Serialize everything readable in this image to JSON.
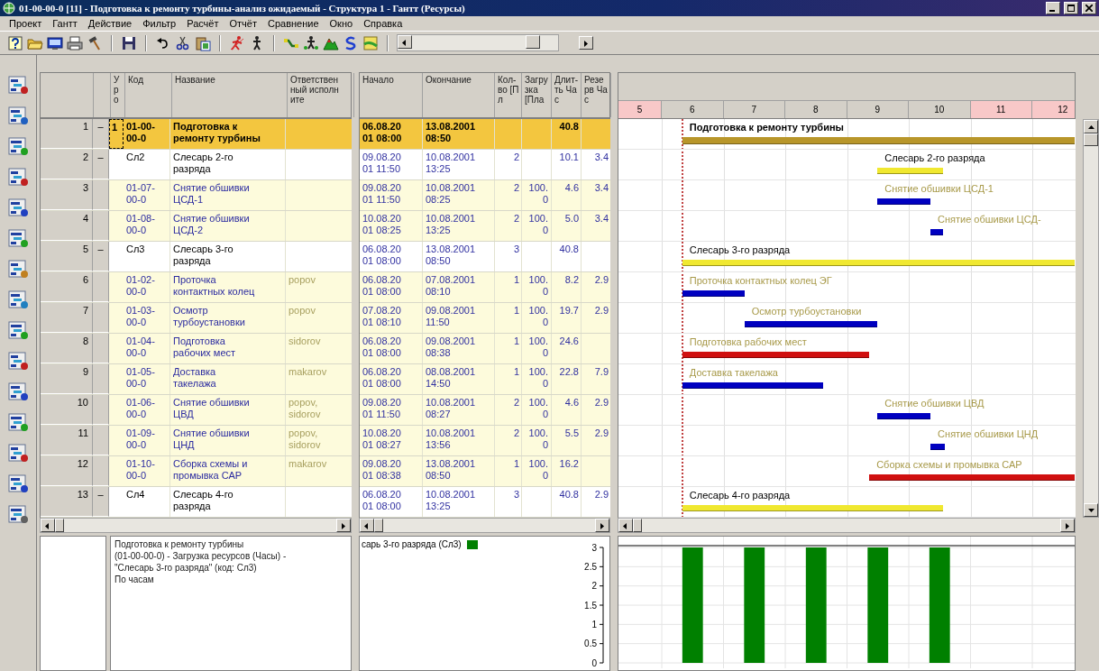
{
  "window": {
    "title": "01-00-00-0 [11] - Подготовка к ремонту турбины-анализ ожидаемый - Структура 1 - Гантт (Ресурсы)"
  },
  "menu": [
    "Проект",
    "Гантт",
    "Действие",
    "Фильтр",
    "Расчёт",
    "Отчёт",
    "Сравнение",
    "Окно",
    "Справка"
  ],
  "table": {
    "left_columns": [
      "Уро",
      "Код",
      "Название",
      "Ответственный исполните"
    ],
    "right_columns": [
      "Начало",
      "Окончание",
      "Кол-во [Пл",
      "Загрузка [Пла",
      "Длит-ть Час",
      "Резерв Час"
    ],
    "rows": [
      {
        "num": "1",
        "marker": "–",
        "outline_level": "1",
        "code": "01-00-00-0",
        "name": "Подготовка к ремонту турбины",
        "start": "06.08.2001 08:00",
        "end": "13.08.2001 08:50",
        "duration": "40.8",
        "kind": "summary",
        "selected": true
      },
      {
        "num": "2",
        "marker": "–",
        "code": "Сл2",
        "name": "Слесарь 2-го разряда",
        "start": "09.08.2001 11:50",
        "end": "10.08.2001 13:25",
        "qty": "2",
        "duration": "10.1",
        "reserve": "3.4",
        "kind": "resource",
        "selected": false
      },
      {
        "num": "3",
        "code": "01-07-00-0",
        "name": "Снятие обшивки ЦСД-1",
        "start": "09.08.2001 11:50",
        "end": "10.08.2001 08:25",
        "qty": "2",
        "load": "100.0",
        "duration": "4.6",
        "reserve": "3.4",
        "kind": "task",
        "selected": false
      },
      {
        "num": "4",
        "code": "01-08-00-0",
        "name": "Снятие обшивки ЦСД-2",
        "start": "10.08.2001 08:25",
        "end": "10.08.2001 13:25",
        "qty": "2",
        "load": "100.0",
        "duration": "5.0",
        "reserve": "3.4",
        "kind": "task",
        "selected": false
      },
      {
        "num": "5",
        "marker": "–",
        "code": "Сл3",
        "name": "Слесарь 3-го разряда",
        "start": "06.08.2001 08:00",
        "end": "13.08.2001 08:50",
        "qty": "3",
        "duration": "40.8",
        "kind": "resource",
        "selected": false
      },
      {
        "num": "6",
        "code": "01-02-00-0",
        "name": "Проточка контактных колец",
        "responsible": "popov",
        "start": "06.08.2001 08:00",
        "end": "07.08.2001 08:10",
        "qty": "1",
        "load": "100.0",
        "duration": "8.2",
        "reserve": "2.9",
        "kind": "task",
        "selected": false
      },
      {
        "num": "7",
        "code": "01-03-00-0",
        "name": "Осмотр турбоустановки",
        "responsible": "popov",
        "start": "07.08.2001 08:10",
        "end": "09.08.2001 11:50",
        "qty": "1",
        "load": "100.0",
        "duration": "19.7",
        "reserve": "2.9",
        "kind": "task",
        "selected": false
      },
      {
        "num": "8",
        "code": "01-04-00-0",
        "name": "Подготовка рабочих мест",
        "responsible": "sidorov",
        "start": "06.08.2001 08:00",
        "end": "09.08.2001 08:38",
        "qty": "1",
        "load": "100.0",
        "duration": "24.6",
        "kind": "task",
        "selected": false
      },
      {
        "num": "9",
        "code": "01-05-00-0",
        "name": "Доставка такелажа",
        "responsible": "makarov",
        "start": "06.08.2001 08:00",
        "end": "08.08.2001 14:50",
        "qty": "1",
        "load": "100.0",
        "duration": "22.8",
        "reserve": "7.9",
        "kind": "task",
        "selected": false
      },
      {
        "num": "10",
        "code": "01-06-00-0",
        "name": "Снятие обшивки ЦВД",
        "responsible": "popov, sidorov",
        "start": "09.08.2001 11:50",
        "end": "10.08.2001 08:27",
        "qty": "2",
        "load": "100.0",
        "duration": "4.6",
        "reserve": "2.9",
        "kind": "task",
        "selected": false
      },
      {
        "num": "11",
        "code": "01-09-00-0",
        "name": "Снятие обшивки ЦНД",
        "responsible": "popov, sidorov",
        "start": "10.08.2001 08:27",
        "end": "10.08.2001 13:56",
        "qty": "2",
        "load": "100.0",
        "duration": "5.5",
        "reserve": "2.9",
        "kind": "task",
        "selected": false
      },
      {
        "num": "12",
        "code": "01-10-00-0",
        "name": "Сборка схемы и промывка САР",
        "responsible": "makarov",
        "start": "09.08.2001 08:38",
        "end": "13.08.2001 08:50",
        "qty": "1",
        "load": "100.0",
        "duration": "16.2",
        "kind": "task",
        "selected": false
      },
      {
        "num": "13",
        "marker": "–",
        "code": "Сл4",
        "name": "Слесарь 4-го разряда",
        "start": "06.08.2001 08:00",
        "end": "10.08.2001 13:25",
        "qty": "3",
        "duration": "40.8",
        "reserve": "2.9",
        "kind": "resource",
        "selected": false
      }
    ]
  },
  "gantt": {
    "days": [
      {
        "label": "5",
        "weekend": true
      },
      {
        "label": "6",
        "weekend": false
      },
      {
        "label": "7",
        "weekend": false
      },
      {
        "label": "8",
        "weekend": false
      },
      {
        "label": "9",
        "weekend": false
      },
      {
        "label": "10",
        "weekend": false
      },
      {
        "label": "11",
        "weekend": true
      },
      {
        "label": "12",
        "weekend": true
      }
    ],
    "bars": [
      {
        "label": "Подготовка к ремонту турбины",
        "kind": "summary",
        "color": "#b8962a"
      },
      {
        "label": "Слесарь 2-го разряда",
        "kind": "resource",
        "color": "#f0e830"
      },
      {
        "label": "Снятие обшивки ЦСД-1",
        "kind": "task",
        "color": "#0000c0"
      },
      {
        "label": "Снятие обшивки ЦСД-",
        "kind": "task",
        "color": "#0000c0"
      },
      {
        "label": "Слесарь 3-го разряда",
        "kind": "resource",
        "color": "#f0e830"
      },
      {
        "label": "Проточка контактных колец ЭГ",
        "kind": "task",
        "color": "#0000c0"
      },
      {
        "label": "Осмотр турбоустановки",
        "kind": "task",
        "color": "#0000c0"
      },
      {
        "label": "Подготовка рабочих мест",
        "kind": "task",
        "color": "#d01010"
      },
      {
        "label": "Доставка такелажа",
        "kind": "task",
        "color": "#0000c0"
      },
      {
        "label": "Снятие обшивки ЦВД",
        "kind": "task",
        "color": "#0000c0"
      },
      {
        "label": "Снятие обшивки ЦНД",
        "kind": "task",
        "color": "#0000c0"
      },
      {
        "label": "Сборка схемы и промывка САР",
        "kind": "task",
        "color": "#d01010"
      },
      {
        "label": "Слесарь 4-го разряда",
        "kind": "resource",
        "color": "#f0e830"
      }
    ]
  },
  "info_panel": {
    "lines": [
      "Подготовка к ремонту турбины",
      "(01-00-00-0) - Загрузка ресурсов (Часы) -",
      "\"Слесарь 3-го разряда\" (код: Сл3)",
      "По часам"
    ]
  },
  "load_chart": {
    "chart_data": {
      "type": "bar",
      "grid": true,
      "series": [
        {
          "name": "сарь 3-го разряда (Сл3)",
          "color": "#008000",
          "values": [
            3,
            3,
            3,
            3,
            3
          ]
        }
      ],
      "ylim": [
        0,
        3
      ],
      "yticks": [
        0,
        0.5,
        1,
        1.5,
        2,
        2.5,
        3
      ]
    }
  }
}
